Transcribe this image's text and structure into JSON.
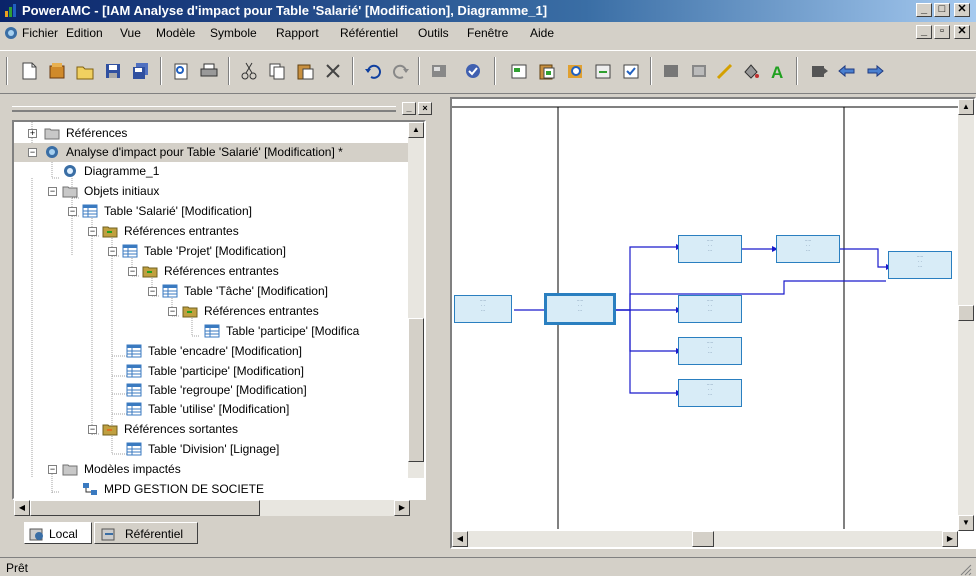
{
  "window": {
    "title": "PowerAMC - [IAM Analyse d'impact pour Table 'Salarié' [Modification], Diagramme_1]",
    "buttons": [
      "_",
      "□",
      "✕"
    ]
  },
  "menubar": {
    "items": [
      "Fichier",
      "Edition",
      "Vue",
      "Modèle",
      "Symbole",
      "Rapport",
      "Référentiel",
      "Outils",
      "Fenêtre",
      "Aide"
    ],
    "right_buttons": [
      "_",
      "▫",
      "✕"
    ]
  },
  "toolbar": {
    "icons": [
      "new-icon",
      "open-model-icon",
      "open-folder-icon",
      "save-icon",
      "save-all-icon",
      "print-preview-icon",
      "print-icon",
      "cut-icon",
      "copy-icon",
      "paste-icon",
      "delete-icon",
      "undo-icon",
      "redo-icon",
      "model-properties-icon",
      "check-model-icon",
      "new-package-icon",
      "paste-diagram-icon",
      "find-icon",
      "import-icon",
      "check-icon",
      "fill-format-icon",
      "line-format-icon",
      "pen-icon",
      "color-fill-icon",
      "text-color-icon",
      "move-icon",
      "back-icon",
      "forward-icon"
    ]
  },
  "browser": {
    "nodes": [
      {
        "label": "Références",
        "icon": "folder-icon",
        "exp": "+"
      },
      {
        "label": "Analyse d'impact pour Table 'Salarié' [Modification] *",
        "icon": "impact-analysis-icon",
        "exp": "−"
      },
      {
        "label": "Diagramme_1",
        "icon": "diagram-icon",
        "exp": ""
      },
      {
        "label": "Objets initiaux",
        "icon": "folder-icon",
        "exp": "−"
      },
      {
        "label": "Table 'Salarié' [Modification]",
        "icon": "table-icon",
        "exp": "−"
      },
      {
        "label": "Références entrantes",
        "icon": "incoming-references-icon",
        "exp": "−"
      },
      {
        "label": "Table 'Projet' [Modification]",
        "icon": "table-icon",
        "exp": "−"
      },
      {
        "label": "Références entrantes",
        "icon": "incoming-references-icon",
        "exp": "−"
      },
      {
        "label": "Table 'Tâche' [Modification]",
        "icon": "table-icon",
        "exp": "−"
      },
      {
        "label": "Références entrantes",
        "icon": "incoming-references-icon",
        "exp": "−"
      },
      {
        "label": "Table 'participe' [Modifica",
        "icon": "table-icon",
        "exp": ""
      },
      {
        "label": "Table 'encadre' [Modification]",
        "icon": "table-icon",
        "exp": ""
      },
      {
        "label": "Table 'participe' [Modification]",
        "icon": "table-icon",
        "exp": ""
      },
      {
        "label": "Table 'regroupe' [Modification]",
        "icon": "table-icon",
        "exp": ""
      },
      {
        "label": "Table 'utilise' [Modification]",
        "icon": "table-icon",
        "exp": ""
      },
      {
        "label": "Références sortantes",
        "icon": "outgoing-references-icon",
        "exp": "−"
      },
      {
        "label": "Table 'Division' [Lignage]",
        "icon": "table-icon",
        "exp": ""
      },
      {
        "label": "Modèles impactés",
        "icon": "folder-icon",
        "exp": "−"
      },
      {
        "label": "MPD GESTION DE SOCIETE",
        "icon": "physical-model-icon",
        "exp": ""
      }
    ]
  },
  "tabs": {
    "local": "Local",
    "referentiel": "Référentiel"
  },
  "status": {
    "text": "Prêt"
  },
  "colors": {
    "title_start": "#0a246a",
    "title_end": "#a6caf0",
    "link": "#1a1acc",
    "box_border": "#2a7fc0"
  }
}
